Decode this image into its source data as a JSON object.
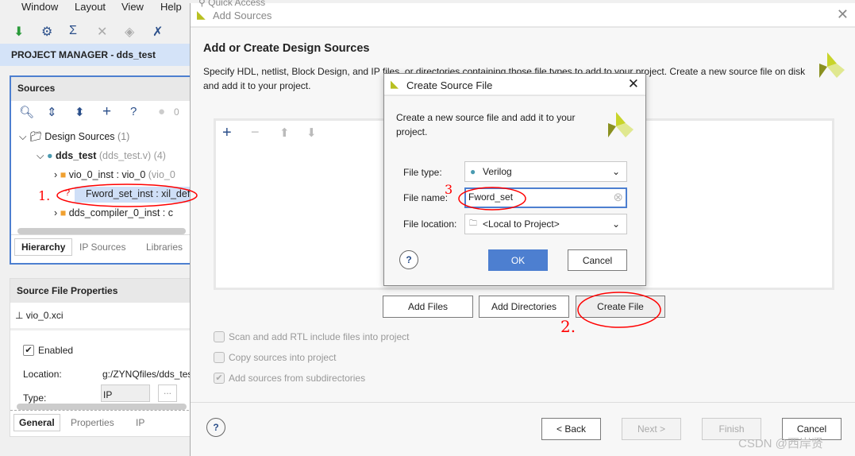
{
  "menu": [
    "Window",
    "Layout",
    "View",
    "Help"
  ],
  "quick_access": "Quick Access",
  "project_header": "PROJECT MANAGER - dds_test",
  "sources": {
    "title": "Sources",
    "error_count": "0",
    "tree": [
      {
        "label": "Design Sources",
        "extra": "(1)"
      },
      {
        "label": "dds_test",
        "extra": "(dds_test.v) (4)"
      },
      {
        "label": "vio_0_inst : vio_0",
        "extra": "(vio_0"
      },
      {
        "label": "Fword_set_inst : xil_defau",
        "extra": ""
      },
      {
        "label": "dds_compiler_0_inst : c",
        "extra": ""
      }
    ],
    "tabs": [
      "Hierarchy",
      "IP Sources",
      "Libraries"
    ]
  },
  "props": {
    "title": "Source File Properties",
    "file": "vio_0.xci",
    "enabled": "Enabled",
    "location_label": "Location:",
    "location_value": "g:/ZYNQfiles/dds_tes",
    "type_label": "Type:",
    "type_value": "IP",
    "browse": "...",
    "tabs": [
      "General",
      "Properties",
      "IP"
    ]
  },
  "add_sources": {
    "title": "Add Sources",
    "heading": "Add or Create Design Sources",
    "desc": "Specify HDL, netlist, Block Design, and IP files, or directories containing those file types to add to your project. Create a new source file on disk and add it to your project.",
    "buttons": {
      "add_files": "Add Files",
      "add_dirs": "Add Directories",
      "create_file": "Create File"
    },
    "options": [
      {
        "label": "Scan and add RTL include files into project",
        "checked": false
      },
      {
        "label": "Copy sources into project",
        "checked": false
      },
      {
        "label": "Add sources from subdirectories",
        "checked": true
      }
    ],
    "footer": {
      "back": "< Back",
      "next": "Next >",
      "finish": "Finish",
      "cancel": "Cancel"
    }
  },
  "create_dialog": {
    "title": "Create Source File",
    "desc": "Create a new source file and add it to your project.",
    "file_type_label": "File type:",
    "file_type": "Verilog",
    "file_name_label": "File name:",
    "file_name": "Fword_set",
    "file_location_label": "File location:",
    "file_location": "<Local to Project>",
    "ok": "OK",
    "cancel": "Cancel"
  },
  "annotations": [
    "1.",
    "2.",
    "3"
  ],
  "watermark": "CSDN @西岸贤",
  "colors": {
    "accent": "#4d7fd0",
    "header": "#d4e3f8",
    "annotation": "#ff0000"
  }
}
